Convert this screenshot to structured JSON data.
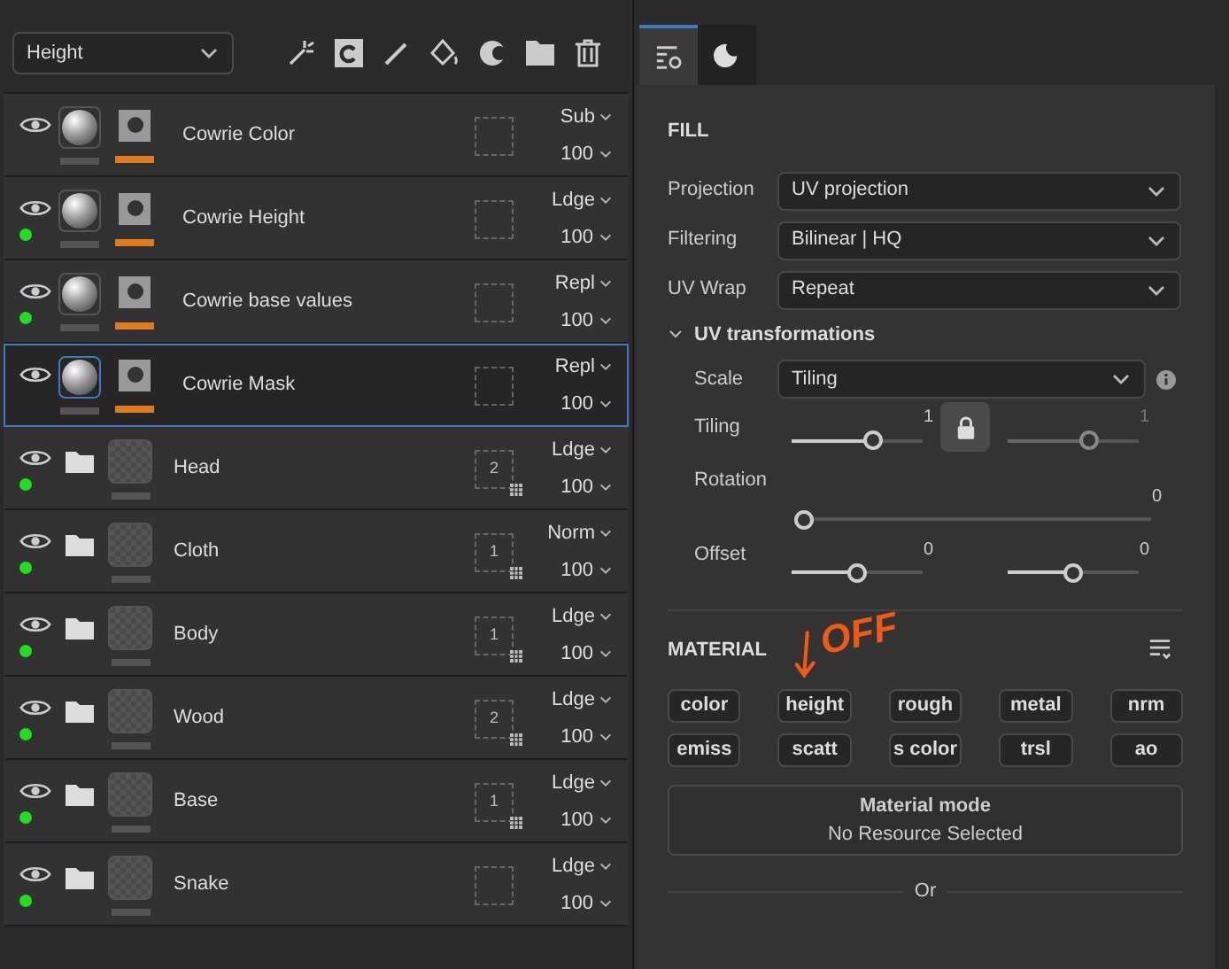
{
  "layers_toolbar": {
    "channel": "Height"
  },
  "layers": [
    {
      "kind": "fill",
      "name": "Cowrie Color",
      "blend": "Sub",
      "opacity": "100",
      "dot": false,
      "selected": false
    },
    {
      "kind": "fill",
      "name": "Cowrie Height",
      "blend": "Ldge",
      "opacity": "100",
      "dot": true,
      "selected": false
    },
    {
      "kind": "fill",
      "name": "Cowrie base values",
      "blend": "Repl",
      "opacity": "100",
      "dot": true,
      "selected": false
    },
    {
      "kind": "fill",
      "name": "Cowrie Mask",
      "blend": "Repl",
      "opacity": "100",
      "dot": false,
      "selected": true
    },
    {
      "kind": "folder",
      "name": "Head",
      "mask_count": "2",
      "blend": "Ldge",
      "opacity": "100",
      "dot": true,
      "selected": false
    },
    {
      "kind": "folder",
      "name": "Cloth",
      "mask_count": "1",
      "blend": "Norm",
      "opacity": "100",
      "dot": true,
      "selected": false
    },
    {
      "kind": "folder",
      "name": "Body",
      "mask_count": "1",
      "blend": "Ldge",
      "opacity": "100",
      "dot": true,
      "selected": false
    },
    {
      "kind": "folder",
      "name": "Wood",
      "mask_count": "2",
      "blend": "Ldge",
      "opacity": "100",
      "dot": true,
      "selected": false
    },
    {
      "kind": "folder",
      "name": "Base",
      "mask_count": "1",
      "blend": "Ldge",
      "opacity": "100",
      "dot": true,
      "selected": false
    },
    {
      "kind": "folder",
      "name": "Snake",
      "blend": "Ldge",
      "opacity": "100",
      "dot": true,
      "selected": false
    }
  ],
  "properties": {
    "tabs": [
      {
        "kind": "settings",
        "selected": true
      },
      {
        "kind": "material",
        "selected": false
      }
    ],
    "fill": {
      "title": "FILL",
      "fields": [
        {
          "label": "Projection",
          "value": "UV projection"
        },
        {
          "label": "Filtering",
          "value": "Bilinear | HQ"
        },
        {
          "label": "UV Wrap",
          "value": "Repeat"
        }
      ],
      "uv_transformations": {
        "title": "UV transformations",
        "expanded": true,
        "scale": {
          "label": "Scale",
          "value": "Tiling"
        },
        "tiling": {
          "label": "Tiling",
          "locked": true,
          "sliders": [
            {
              "reading": "1",
              "level": 0.62
            },
            {
              "reading": "1",
              "level": 0.62
            }
          ]
        },
        "rotation": {
          "label": "Rotation",
          "sliders": [
            {
              "reading": "0",
              "level": 0
            }
          ]
        },
        "offset": {
          "label": "Offset",
          "sliders": [
            {
              "reading": "0",
              "level": 0.5
            },
            {
              "reading": "0",
              "level": 0.5
            }
          ]
        }
      }
    },
    "material": {
      "title": "MATERIAL",
      "annotation": "OFF",
      "channels": [
        "color",
        "height",
        "rough",
        "metal",
        "nrm",
        "emiss",
        "scatt",
        "s color",
        "trsl",
        "ao"
      ],
      "mode": {
        "title": "Material mode",
        "subtitle": "No Resource Selected"
      },
      "separator": "Or"
    }
  }
}
